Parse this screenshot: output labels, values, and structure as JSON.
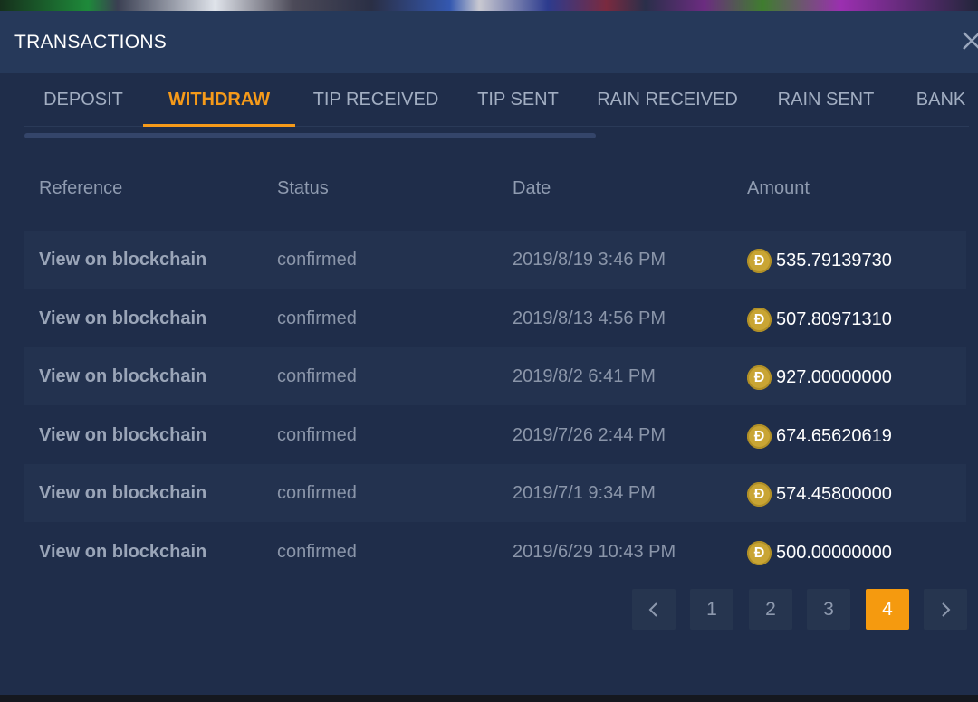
{
  "modal": {
    "title": "TRANSACTIONS",
    "close_icon": "close-icon"
  },
  "tabs": [
    {
      "label": "DEPOSIT",
      "active": false
    },
    {
      "label": "WITHDRAW",
      "active": true
    },
    {
      "label": "TIP RECEIVED",
      "active": false
    },
    {
      "label": "TIP SENT",
      "active": false
    },
    {
      "label": "RAIN RECEIVED",
      "active": false
    },
    {
      "label": "RAIN SENT",
      "active": false
    },
    {
      "label": "BANK",
      "active": false
    }
  ],
  "table": {
    "columns": [
      "Reference",
      "Status",
      "Date",
      "Amount"
    ],
    "rows": [
      {
        "reference": "View on blockchain",
        "status": "confirmed",
        "date": "2019/8/19 3:46 PM",
        "amount": "535.79139730"
      },
      {
        "reference": "View on blockchain",
        "status": "confirmed",
        "date": "2019/8/13 4:56 PM",
        "amount": "507.80971310"
      },
      {
        "reference": "View on blockchain",
        "status": "confirmed",
        "date": "2019/8/2 6:41 PM",
        "amount": "927.00000000"
      },
      {
        "reference": "View on blockchain",
        "status": "confirmed",
        "date": "2019/7/26 2:44 PM",
        "amount": "674.65620619"
      },
      {
        "reference": "View on blockchain",
        "status": "confirmed",
        "date": "2019/7/1 9:34 PM",
        "amount": "574.45800000"
      },
      {
        "reference": "View on blockchain",
        "status": "confirmed",
        "date": "2019/6/29 10:43 PM",
        "amount": "500.00000000"
      }
    ],
    "coin_symbol": "Ð",
    "coin_icon": "dogecoin-icon"
  },
  "pagination": {
    "prev_icon": "chevron-left-icon",
    "next_icon": "chevron-right-icon",
    "pages": [
      "1",
      "2",
      "3",
      "4"
    ],
    "current": "4"
  },
  "colors": {
    "accent": "#f59a1a",
    "background": "#1f2d4a",
    "header": "#26395a",
    "coin": "#c9a534"
  }
}
